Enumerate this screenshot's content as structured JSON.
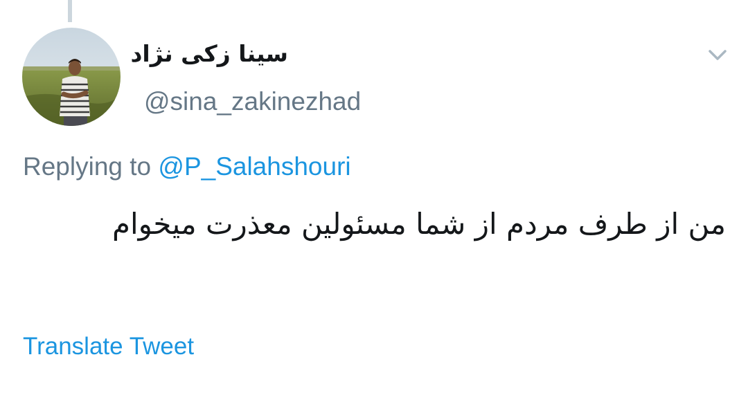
{
  "tweet": {
    "author": {
      "display_name": "سینا زکی نژاد",
      "handle": "@sina_zakinezhad",
      "avatar_icon": "profile-photo"
    },
    "menu_icon": "chevron-down-icon",
    "reply": {
      "prefix": "Replying to",
      "user": "@P_Salahshouri"
    },
    "text": "من از طرف مردم از شما مسئولین معذرت میخوام",
    "translate_label": "Translate Tweet"
  },
  "colors": {
    "link": "#1b95e0",
    "secondary_text": "#657786",
    "primary_text": "#14171a",
    "thread_line": "#ccd6dd"
  }
}
